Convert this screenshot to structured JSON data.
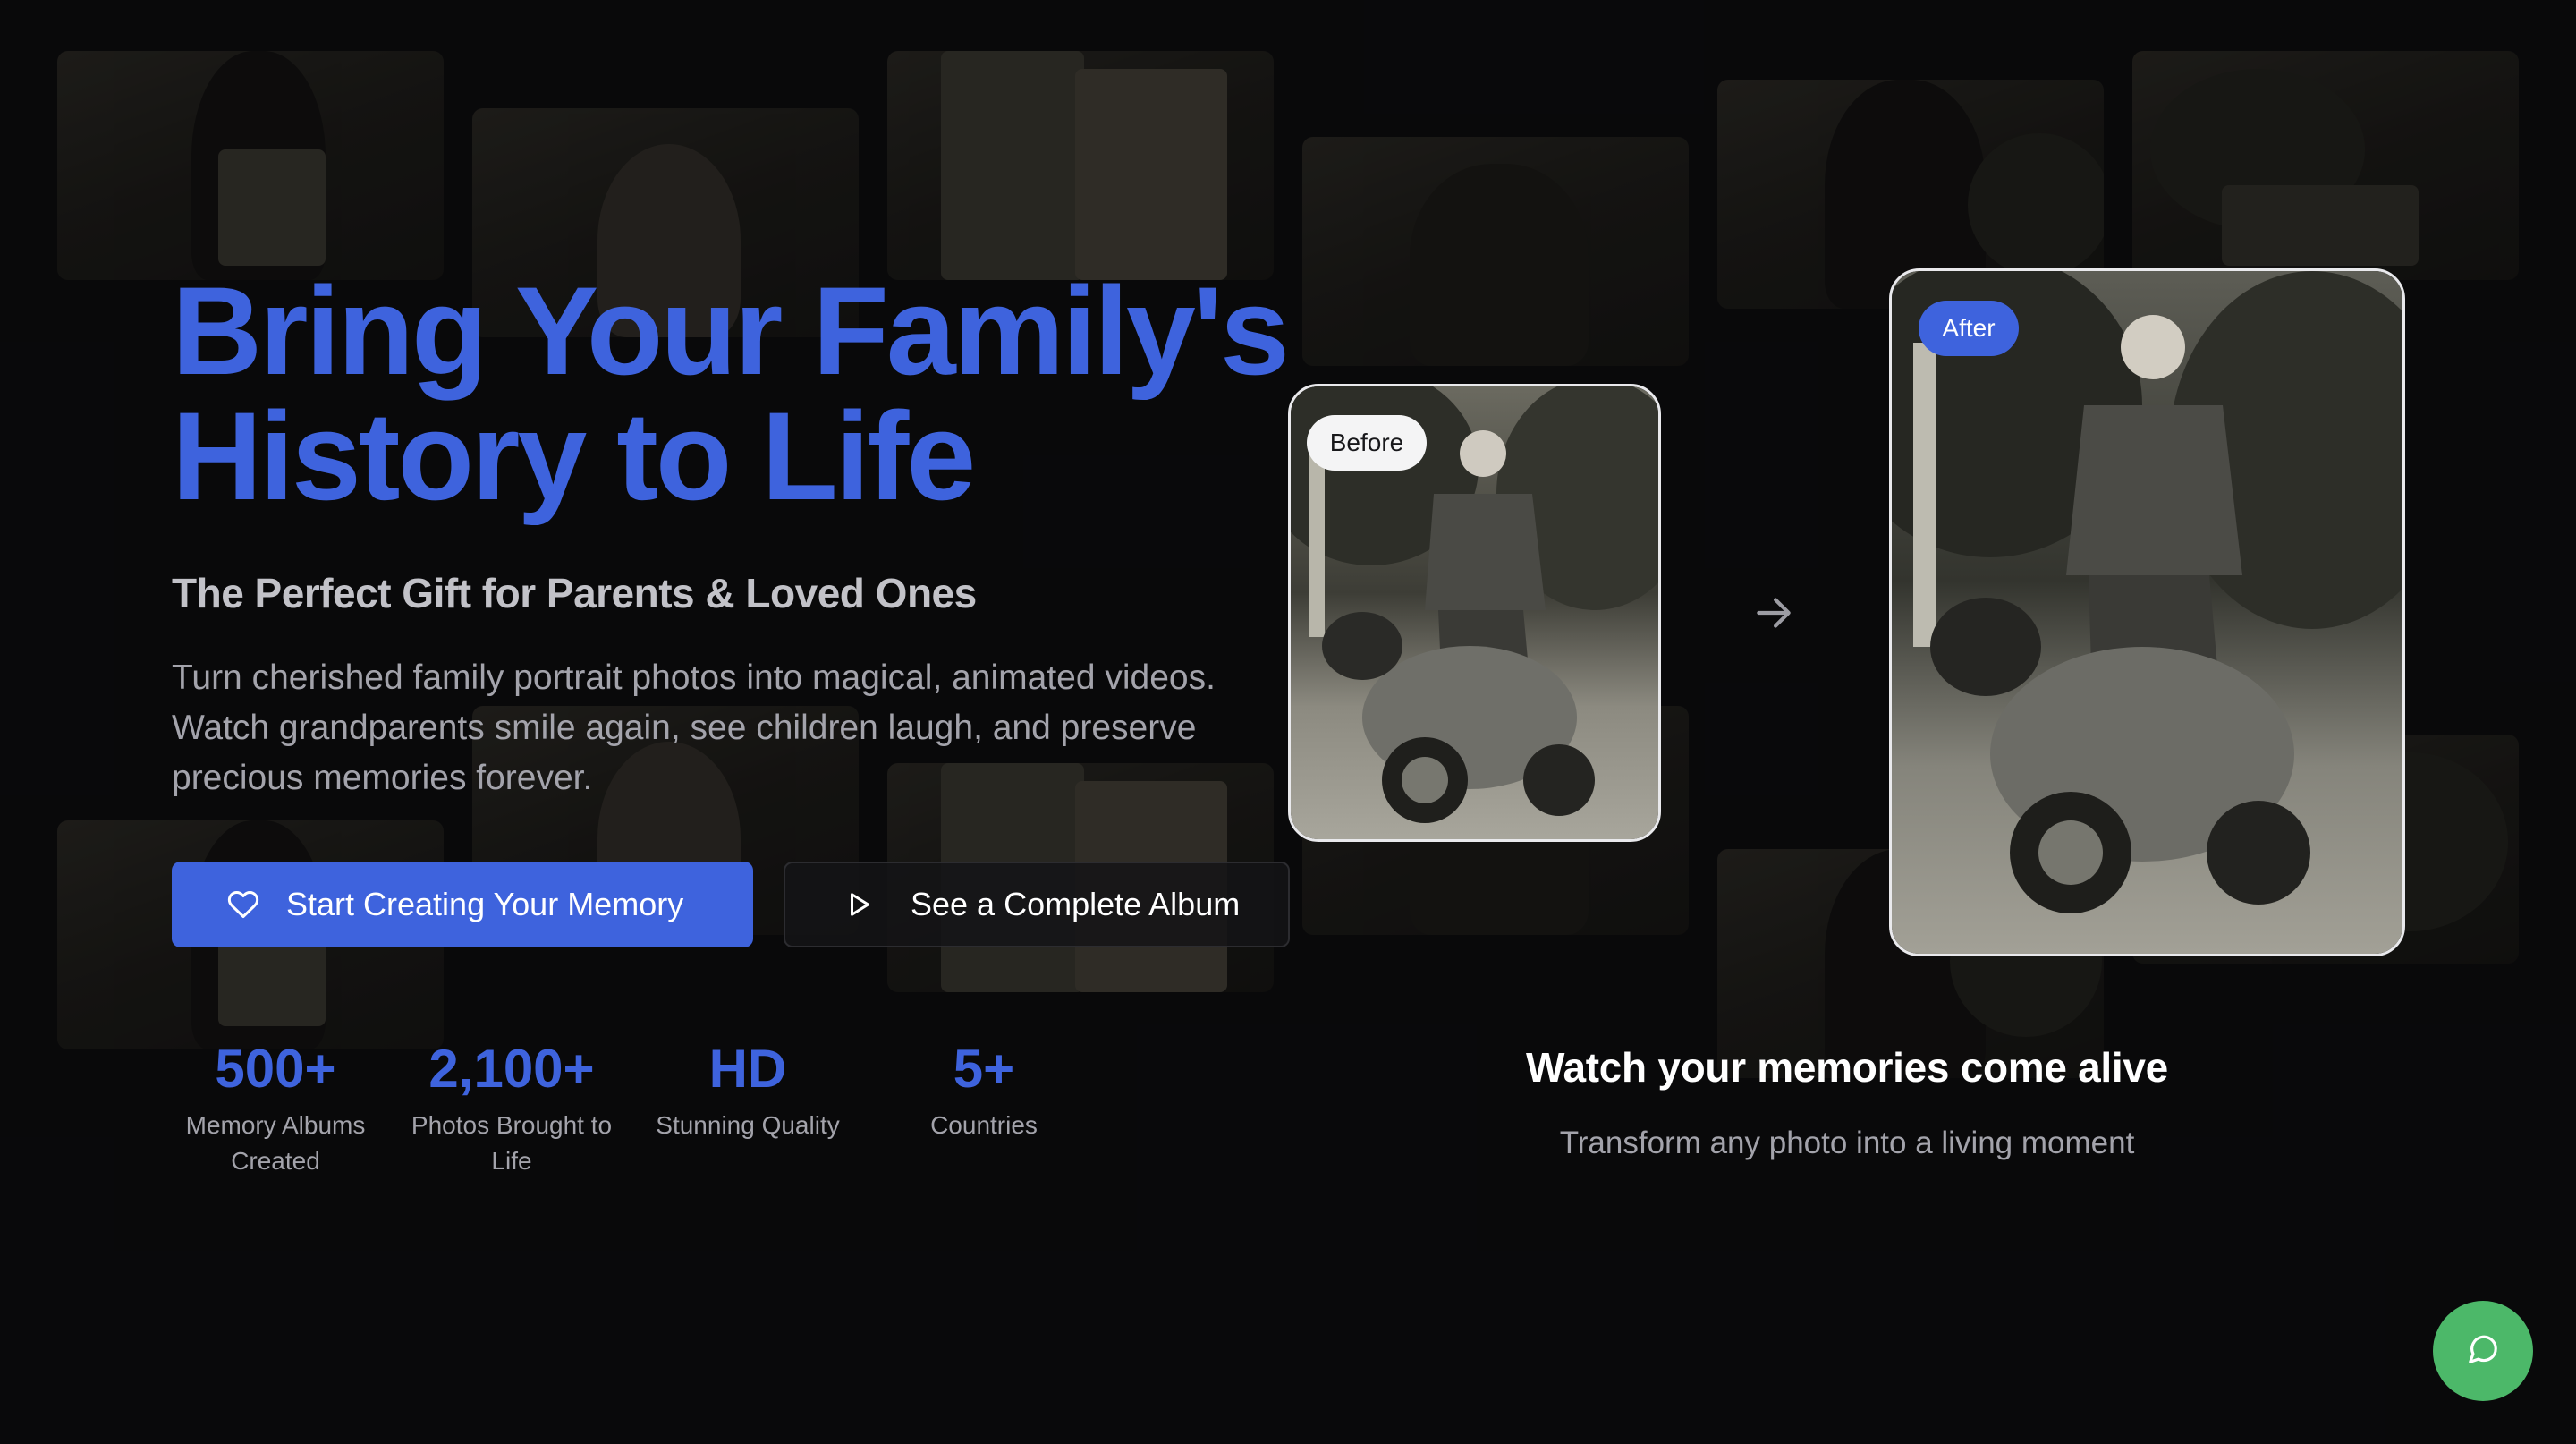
{
  "hero": {
    "title_line1": "Bring Your Family's",
    "title_line2": "History to Life",
    "subtitle": "The Perfect Gift for Parents & Loved Ones",
    "description": "Turn cherished family portrait photos into magical, animated videos. Watch grandparents smile again, see children laugh, and preserve precious memories forever."
  },
  "buttons": {
    "primary_label": "Start Creating Your Memory",
    "primary_icon": "heart-icon",
    "secondary_label": "See a Complete Album",
    "secondary_icon": "play-icon"
  },
  "stats": [
    {
      "value": "500+",
      "label": "Memory Albums Created"
    },
    {
      "value": "2,100+",
      "label": "Photos Brought to Life"
    },
    {
      "value": "HD",
      "label": "Stunning Quality"
    },
    {
      "value": "5+",
      "label": "Countries"
    }
  ],
  "comparison": {
    "before_label": "Before",
    "after_label": "After",
    "arrow_icon": "arrow-right-icon",
    "caption_title": "Watch your memories come alive",
    "caption_subtitle": "Transform any photo into a living moment"
  },
  "chat": {
    "icon": "chat-bubble-icon"
  },
  "colors": {
    "background": "#09090b",
    "accent": "#3e63dd",
    "chat_button": "#4cb869"
  }
}
